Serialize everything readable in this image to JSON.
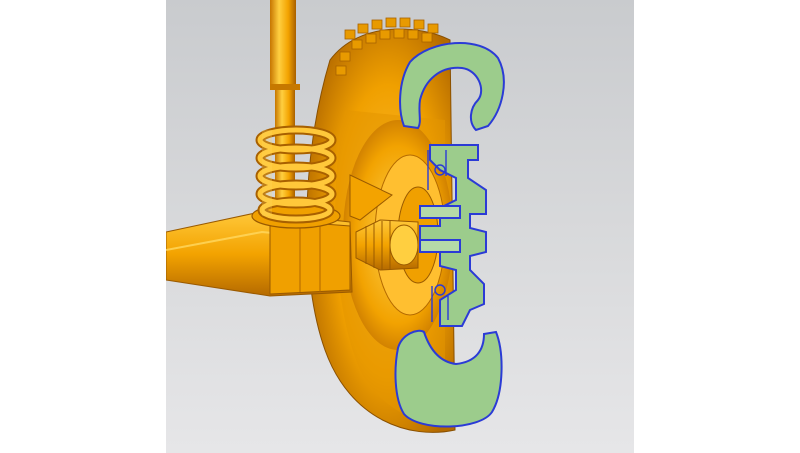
{
  "scene": {
    "kind": "CAD section view",
    "components": [
      "strut-tube",
      "coil-spring",
      "control-arm",
      "tire",
      "wheel-hub",
      "drive-shaft-boot"
    ]
  },
  "colors": {
    "side_background": "#ffffff",
    "viewport_top": "#c9cbce",
    "viewport_bottom": "#e6e6e8",
    "part_orange": "#f3a300",
    "part_orange_light": "#ffc93a",
    "part_orange_dark": "#b86c00",
    "section_fill": "#9ccc8c",
    "section_edge": "#2b3bd6"
  }
}
